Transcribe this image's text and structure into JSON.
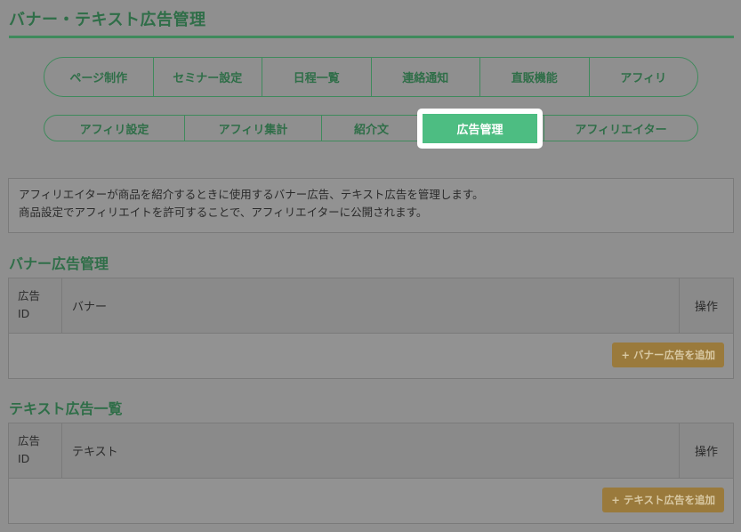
{
  "header": {
    "title": "バナー・テキスト広告管理"
  },
  "main_tabs": [
    {
      "label": "ページ制作"
    },
    {
      "label": "セミナー設定"
    },
    {
      "label": "日程一覧"
    },
    {
      "label": "連絡通知"
    },
    {
      "label": "直販機能"
    },
    {
      "label": "アフィリ"
    }
  ],
  "sub_tabs": [
    {
      "label": "アフィリ設定"
    },
    {
      "label": "アフィリ集計"
    },
    {
      "label": "紹介文"
    },
    {
      "label": "広告管理",
      "active": true
    },
    {
      "label": "アフィリエイター"
    }
  ],
  "info": {
    "line1": "アフィリエイターが商品を紹介するときに使用するバナー広告、テキスト広告を管理します。",
    "line2": "商品設定でアフィリエイトを許可することで、アフィリエイターに公開されます。"
  },
  "banner_section": {
    "title": "バナー広告管理",
    "col_id_line1": "広告",
    "col_id_line2": "ID",
    "col_main": "バナー",
    "col_action": "操作",
    "add_button": "+ バナー広告を追加"
  },
  "text_section": {
    "title": "テキスト広告一覧",
    "col_id_line1": "広告",
    "col_id_line2": "ID",
    "col_main": "テキスト",
    "col_action": "操作",
    "add_button": "+ テキスト広告を追加"
  },
  "colors": {
    "accent_green": "#3f8a5c",
    "active_tab": "#4dbd82",
    "button_bg": "#9a7a3c"
  }
}
